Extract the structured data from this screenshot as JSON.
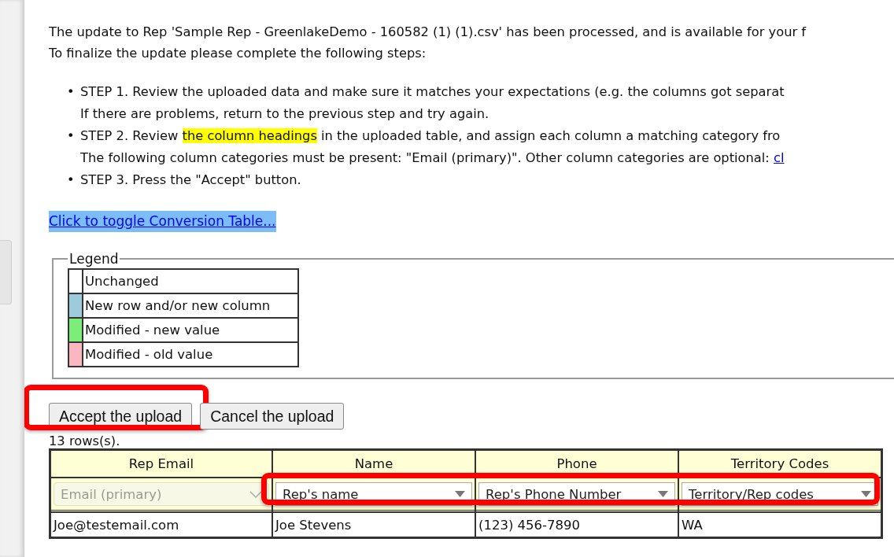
{
  "intro": [
    "The update to Rep 'Sample Rep - GreenlakeDemo - 160582 (1) (1).csv' has been processed, and is available for your f",
    "To finalize the update please complete the following steps:"
  ],
  "steps": [
    {
      "marker": "•",
      "parts": [
        {
          "text": "STEP 1. Review the uploaded data and make sure it matches your expectations (e.g. the columns got separat",
          "highlighted": false
        }
      ],
      "second_line": "If there are problems, return to the previous step and try again."
    },
    {
      "marker": "•",
      "parts": [
        {
          "text": "STEP 2. Review ",
          "highlighted": false
        },
        {
          "text": "the column headings",
          "highlighted": true
        },
        {
          "text": " in the uploaded table, and assign each column a matching category fro",
          "highlighted": false
        }
      ],
      "second_line": "The following column categories must be present: \"Email (primary)\". Other column categories are optional: ",
      "link": "cl"
    },
    {
      "marker": "•",
      "parts": [
        {
          "text": "STEP 3. Press the \"Accept\" button.",
          "highlighted": false
        }
      ]
    }
  ],
  "toggle_link": {
    "label": "Click to toggle Conversion Table...",
    "highlighted": true
  },
  "legend": {
    "title": "Legend",
    "items": [
      {
        "label": "Unchanged",
        "color": "#ffffff"
      },
      {
        "label": "New row and/or new column",
        "color": "#9ecbdc"
      },
      {
        "label": "Modified - new value",
        "color": "#7ded7a"
      },
      {
        "label": "Modified - old value",
        "color": "#fbb6c1"
      }
    ]
  },
  "buttons": [
    {
      "label": "Accept the upload",
      "highlighted": true
    },
    {
      "label": "Cancel the upload",
      "highlighted": false
    }
  ],
  "row_count": "13 rows(s).",
  "table": {
    "columns": [
      "Rep Email",
      "Name",
      "Phone",
      "Territory Codes"
    ],
    "categories_highlighted": true,
    "categories": [
      {
        "value": "Email (primary)",
        "disabled": true
      },
      {
        "value": "Rep's name",
        "disabled": false
      },
      {
        "value": "Rep's Phone Number",
        "disabled": false
      },
      {
        "value": "Territory/Rep codes",
        "disabled": false
      }
    ],
    "rows": [
      [
        "Joe@testemail.com",
        "Joe Stevens",
        "(123) 456-7890",
        "WA"
      ]
    ]
  }
}
